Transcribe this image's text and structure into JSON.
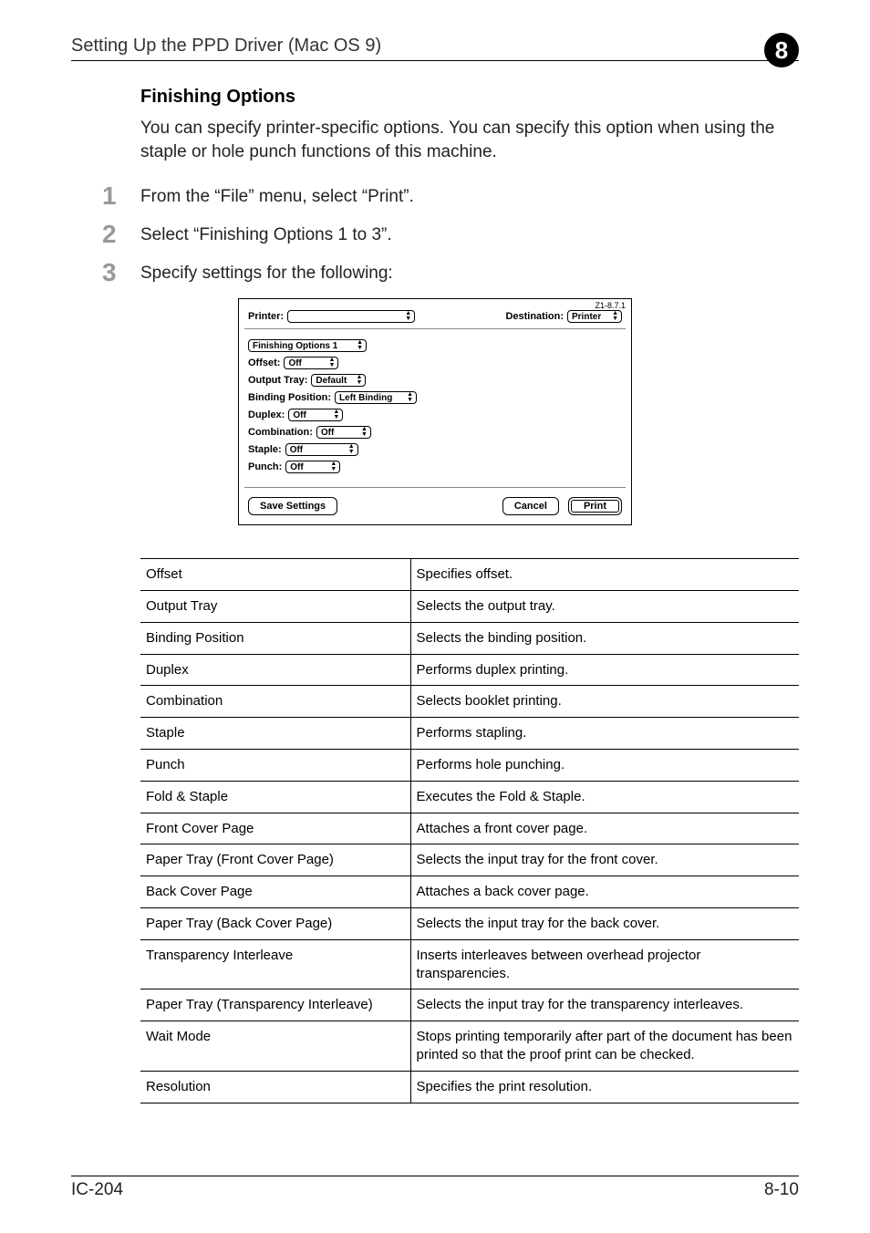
{
  "header": {
    "running_title": "Setting Up the PPD Driver (Mac OS 9)",
    "chapter_number": "8"
  },
  "section": {
    "heading": "Finishing Options",
    "intro": "You can specify printer-specific options. You can specify this option when using the staple or hole punch functions of this machine."
  },
  "steps": [
    {
      "num": "1",
      "text": "From the “File” menu, select “Print”."
    },
    {
      "num": "2",
      "text": "Select “Finishing Options 1 to 3”."
    },
    {
      "num": "3",
      "text": "Specify settings for the following:"
    }
  ],
  "dialog": {
    "version": "Z1-8.7.1",
    "printer_label": "Printer:",
    "printer_value": "",
    "destination_label": "Destination:",
    "destination_value": "Printer",
    "panel": "Finishing Options 1",
    "rows": [
      {
        "label": "Offset:",
        "value": "Off"
      },
      {
        "label": "Output Tray:",
        "value": "Default"
      },
      {
        "label": "Binding Position:",
        "value": "Left Binding"
      },
      {
        "label": "Duplex:",
        "value": "Off"
      },
      {
        "label": "Combination:",
        "value": "Off"
      },
      {
        "label": "Staple:",
        "value": "Off"
      },
      {
        "label": "Punch:",
        "value": "Off"
      }
    ],
    "save_settings": "Save Settings",
    "cancel": "Cancel",
    "print": "Print"
  },
  "options_table": [
    {
      "name": "Offset",
      "desc": "Specifies offset."
    },
    {
      "name": "Output Tray",
      "desc": "Selects the output tray."
    },
    {
      "name": "Binding Position",
      "desc": "Selects the binding position."
    },
    {
      "name": "Duplex",
      "desc": "Performs duplex printing."
    },
    {
      "name": "Combination",
      "desc": "Selects booklet printing."
    },
    {
      "name": "Staple",
      "desc": "Performs stapling."
    },
    {
      "name": "Punch",
      "desc": "Performs hole punching."
    },
    {
      "name": "Fold & Staple",
      "desc": "Executes the Fold & Staple."
    },
    {
      "name": "Front Cover Page",
      "desc": "Attaches a front cover page."
    },
    {
      "name": "Paper Tray (Front Cover Page)",
      "desc": "Selects the input tray for the front cover."
    },
    {
      "name": "Back Cover Page",
      "desc": "Attaches a back cover page."
    },
    {
      "name": "Paper Tray (Back Cover Page)",
      "desc": "Selects the input tray for the back cover."
    },
    {
      "name": "Transparency Interleave",
      "desc": "Inserts interleaves between overhead projector transparencies."
    },
    {
      "name": "Paper Tray (Transparency Interleave)",
      "desc": "Selects the input tray for the transparency interleaves."
    },
    {
      "name": "Wait Mode",
      "desc": "Stops printing temporarily after part of the document has been printed so that the proof print can be checked."
    },
    {
      "name": "Resolution",
      "desc": "Specifies the print resolution."
    }
  ],
  "footer": {
    "model": "IC-204",
    "page": "8-10"
  }
}
